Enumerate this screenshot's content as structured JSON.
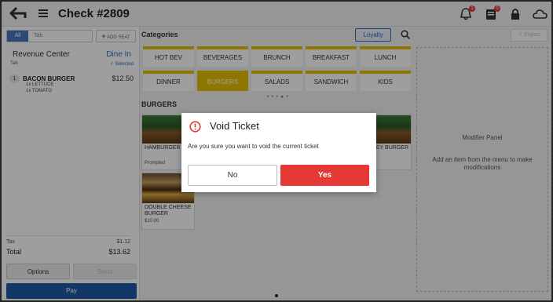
{
  "header": {
    "title": "Check #2809",
    "notifications_badge": "1",
    "orders_badge": "0"
  },
  "left": {
    "tabs": [
      "All",
      "Tab"
    ],
    "add_seat": "ADD SEAT",
    "revenue_center": "Revenue Center",
    "dine_in": "Dine In",
    "tab_label": "Tab",
    "selected": "Selected",
    "item": {
      "qty": "1",
      "name": "BACON BURGER",
      "price": "$12.50",
      "mods": [
        "1x LETTUCE",
        "1x TOMATO"
      ]
    },
    "tax_label": "Tax",
    "tax_value": "$1.12",
    "total_label": "Total",
    "total_value": "$13.62",
    "options": "Options",
    "send": "Send",
    "pay": "Pay"
  },
  "middle": {
    "categories_label": "Categories",
    "loyalty": "Loyalty",
    "categories": [
      "HOT BEV",
      "BEVERAGES",
      "BRUNCH",
      "BREAKFAST",
      "LUNCH",
      "DINNER",
      "BURGERS",
      "SALADS",
      "SANDWICH",
      "KIDS"
    ],
    "selected_category": "BURGERS",
    "section_label": "BURGERS",
    "items": [
      {
        "name": "HAMBURGER",
        "price": "Prompted"
      },
      {
        "name": "EY BURGER",
        "price": ""
      },
      {
        "name": "DOUBLE CHEESE BURGER",
        "price": "$10.00"
      }
    ]
  },
  "right": {
    "export": "Export",
    "panel_title": "Modifier Panel",
    "panel_sub": "Add an item from the menu to make modifications"
  },
  "dialog": {
    "title": "Void Ticket",
    "message": "Are you sure you want to void the current ticket",
    "no": "No",
    "yes": "Yes"
  },
  "colors": {
    "accent": "#1f5aa6",
    "category": "#e6c100",
    "danger": "#e53935"
  }
}
